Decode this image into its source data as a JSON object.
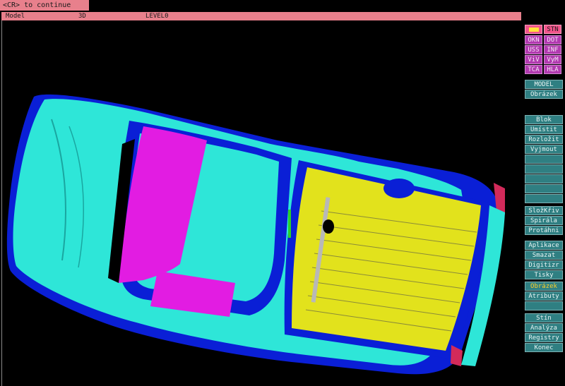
{
  "prompt": {
    "text": "<CR> to continue"
  },
  "status": {
    "mode": "Model",
    "view": "3D",
    "level": "LEVEL0"
  },
  "colors": {
    "accent_pink": "#e8808c",
    "panel_button": "#2f7f82",
    "magenta_button": "#b23ab0",
    "body_cyan": "#2ee6d8",
    "body_blue": "#0a1fd6",
    "floor_yellow": "#e2e21c",
    "glass_magenta": "#e21ce2"
  },
  "toolbox": {
    "swatch_icon": "yellow-swatch-icon",
    "stn": "STN",
    "row2": [
      "OKN",
      "DOT"
    ],
    "row3": [
      "USS",
      "INF"
    ],
    "row4": [
      "ViV",
      "VyM"
    ],
    "row5": [
      "TCA",
      "HLA"
    ]
  },
  "menu": {
    "model": "MODEL",
    "obrazek_top": "Obrázek",
    "blok": "Blok",
    "umistit": "Umístit",
    "rozlozit": "Rozložit",
    "vyjmout": "Vyjmout",
    "slozkriv": "SložKřiv",
    "spirala": "Spirála",
    "protahni": "Protáhni",
    "aplikace": "Aplikace",
    "smazat": "Smazat",
    "digitizr": "Digitizr",
    "tisky": "Tisky",
    "obrazek_sel": "Obrázek",
    "atributy": "Atributy",
    "stin": "Stín",
    "analyza": "Analýza",
    "registry": "Registry",
    "konec": "Konec"
  }
}
